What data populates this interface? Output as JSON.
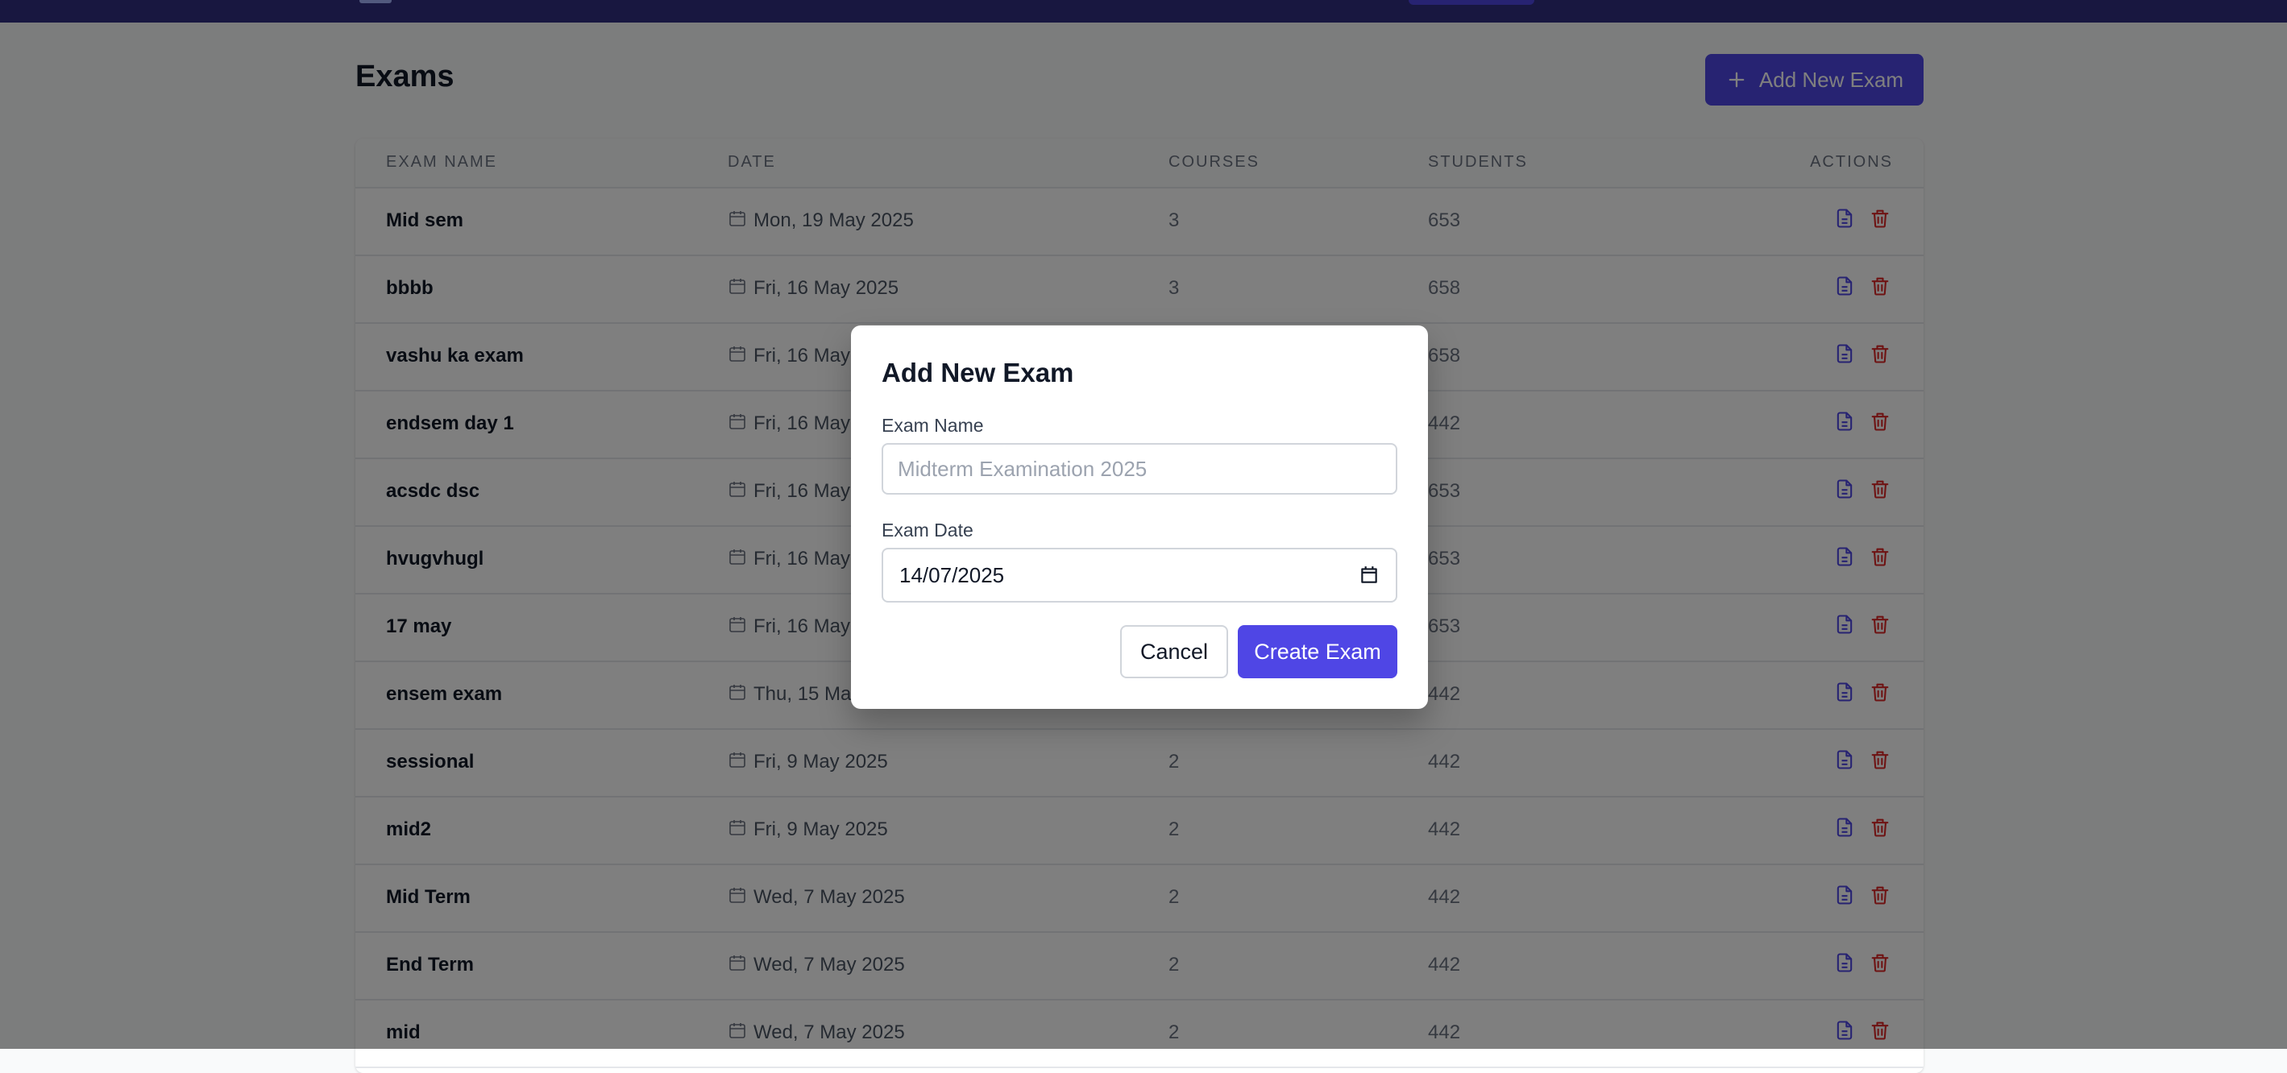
{
  "page": {
    "title": "Exams",
    "add_button_label": "Add New Exam"
  },
  "table": {
    "headers": {
      "exam_name": "EXAM NAME",
      "date": "DATE",
      "courses": "COURSES",
      "students": "STUDENTS",
      "actions": "ACTIONS"
    },
    "rows": [
      {
        "name": "Mid sem",
        "date": "Mon, 19 May 2025",
        "courses": "3",
        "students": "653"
      },
      {
        "name": "bbbb",
        "date": "Fri, 16 May 2025",
        "courses": "3",
        "students": "658"
      },
      {
        "name": "vashu ka exam",
        "date": "Fri, 16 May 2025",
        "courses": "",
        "students": "658"
      },
      {
        "name": "endsem day 1",
        "date": "Fri, 16 May 2025",
        "courses": "",
        "students": "442"
      },
      {
        "name": "acsdc dsc",
        "date": "Fri, 16 May 2025",
        "courses": "",
        "students": "653"
      },
      {
        "name": "hvugvhugl",
        "date": "Fri, 16 May 2025",
        "courses": "",
        "students": "653"
      },
      {
        "name": "17 may",
        "date": "Fri, 16 May 2025",
        "courses": "",
        "students": "653"
      },
      {
        "name": "ensem exam",
        "date": "Thu, 15 May 2025",
        "courses": "",
        "students": "442"
      },
      {
        "name": "sessional",
        "date": "Fri, 9 May 2025",
        "courses": "2",
        "students": "442"
      },
      {
        "name": "mid2",
        "date": "Fri, 9 May 2025",
        "courses": "2",
        "students": "442"
      },
      {
        "name": "Mid Term",
        "date": "Wed, 7 May 2025",
        "courses": "2",
        "students": "442"
      },
      {
        "name": "End Term",
        "date": "Wed, 7 May 2025",
        "courses": "2",
        "students": "442"
      },
      {
        "name": "mid",
        "date": "Wed, 7 May 2025",
        "courses": "2",
        "students": "442"
      }
    ]
  },
  "modal": {
    "title": "Add New Exam",
    "exam_name_label": "Exam Name",
    "exam_name_value": "",
    "exam_name_placeholder": "Midterm Examination 2025",
    "exam_date_label": "Exam Date",
    "exam_date_value": "14/07/2025",
    "cancel_label": "Cancel",
    "create_label": "Create Exam"
  },
  "colors": {
    "primary": "#4f46e5",
    "navbar": "#312e81",
    "danger": "#dc2626"
  },
  "icons": {
    "add": "plus-icon",
    "date": "calendar-icon",
    "view": "document-icon",
    "delete": "trash-icon"
  }
}
